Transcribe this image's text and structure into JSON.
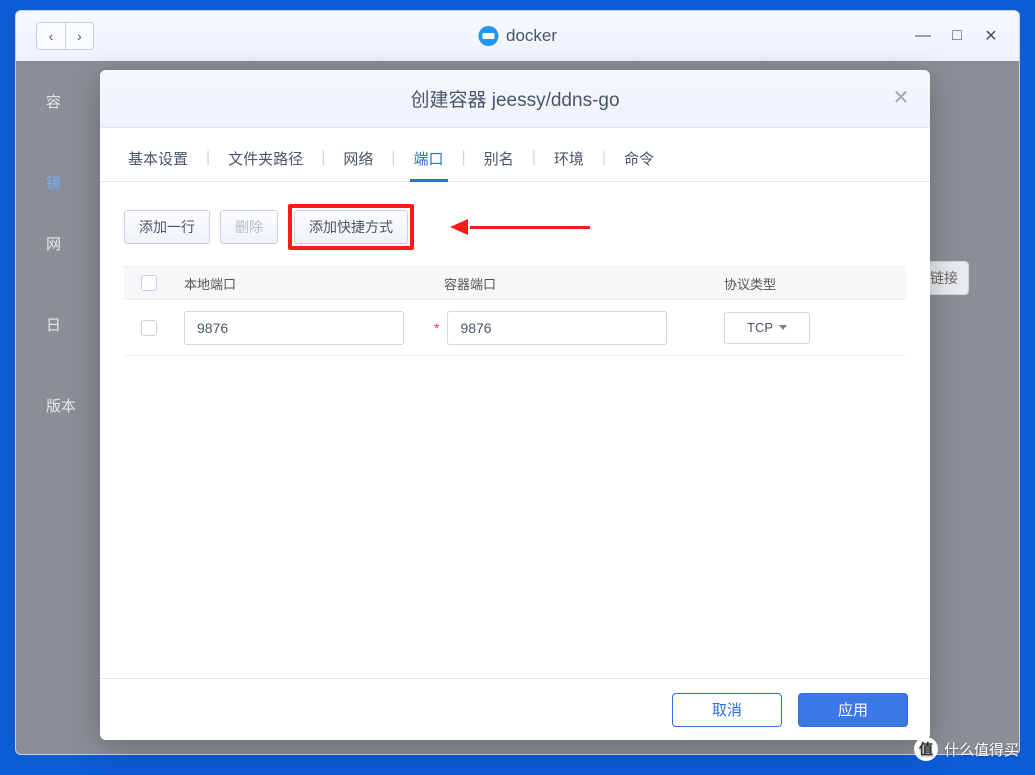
{
  "window": {
    "app_title": "docker",
    "back_glyph": "‹",
    "fwd_glyph": "›",
    "minimize_glyph": "—",
    "maximize_glyph": "□",
    "close_glyph": "✕"
  },
  "background": {
    "label1": "容",
    "label2_blue": "镜",
    "label3": "网",
    "label4": "日",
    "label5": "版本",
    "link_btn": "链接"
  },
  "modal": {
    "title": "创建容器 jeessy/ddns-go",
    "close_glyph": "✕",
    "tabs": [
      "基本设置",
      "文件夹路径",
      "网络",
      "端口",
      "别名",
      "环境",
      "命令"
    ],
    "active_tab_index": 3,
    "toolbar": {
      "add_row": "添加一行",
      "delete": "删除",
      "add_shortcut": "添加快捷方式"
    },
    "table": {
      "headers": {
        "local": "本地端口",
        "container": "容器端口",
        "protocol": "协议类型"
      },
      "rows": [
        {
          "local_port": "9876",
          "container_port": "9876",
          "protocol": "TCP"
        }
      ]
    },
    "footer": {
      "cancel": "取消",
      "apply": "应用"
    }
  },
  "watermark": {
    "badge": "值",
    "text": "什么值得买"
  }
}
